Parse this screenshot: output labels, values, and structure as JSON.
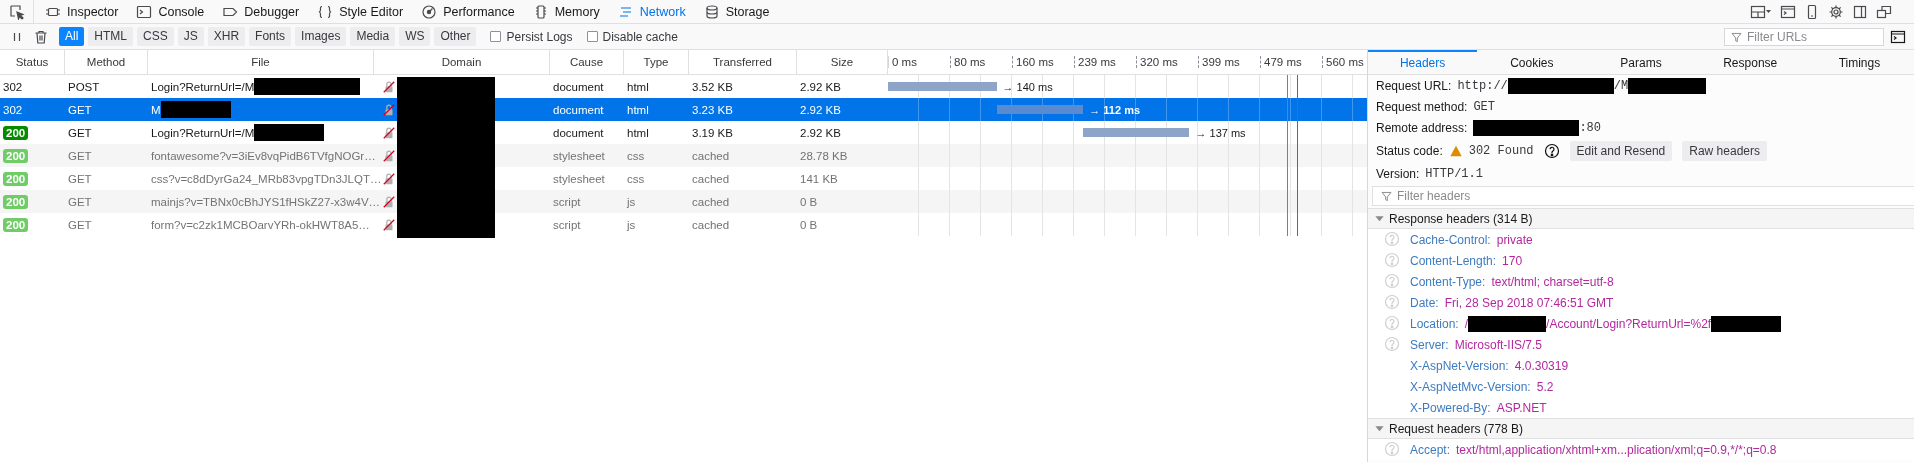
{
  "tools": {
    "tabs": [
      {
        "label": "Inspector",
        "selected": false
      },
      {
        "label": "Console",
        "selected": false
      },
      {
        "label": "Debugger",
        "selected": false
      },
      {
        "label": "Style Editor",
        "selected": false
      },
      {
        "label": "Performance",
        "selected": false
      },
      {
        "label": "Memory",
        "selected": false
      },
      {
        "label": "Network",
        "selected": true
      },
      {
        "label": "Storage",
        "selected": false
      }
    ]
  },
  "filters": {
    "buttons": [
      {
        "label": "All",
        "selected": true
      },
      {
        "label": "HTML",
        "selected": false
      },
      {
        "label": "CSS",
        "selected": false
      },
      {
        "label": "JS",
        "selected": false
      },
      {
        "label": "XHR",
        "selected": false
      },
      {
        "label": "Fonts",
        "selected": false
      },
      {
        "label": "Images",
        "selected": false
      },
      {
        "label": "Media",
        "selected": false
      },
      {
        "label": "WS",
        "selected": false
      },
      {
        "label": "Other",
        "selected": false
      }
    ],
    "checkboxes": [
      {
        "label": "Persist Logs",
        "checked": false
      },
      {
        "label": "Disable cache",
        "checked": false
      }
    ],
    "search": {
      "placeholder": "Filter URLs"
    }
  },
  "table": {
    "columns": [
      "Status",
      "Method",
      "File",
      "Domain",
      "Cause",
      "Type",
      "Transferred",
      "Size"
    ],
    "domain_redacted": true,
    "waterfall": {
      "ticks": [
        "0 ms",
        "80 ms",
        "160 ms",
        "239 ms",
        "320 ms",
        "399 ms",
        "479 ms",
        "560 ms"
      ],
      "markers": [
        {
          "color": "#3d8fd9"
        },
        {
          "color": "#b434b8"
        }
      ]
    },
    "rows": [
      {
        "kind": "redirect",
        "status": "302",
        "method": "POST",
        "file": [
          {
            "kind": "text",
            "text": "Login?ReturnUrl=/M"
          },
          {
            "kind": "redaction"
          }
        ],
        "cause": "document",
        "type": "html",
        "transferred": "3.52 KB",
        "size": "2.92 KB",
        "timing": "→ 140 ms",
        "cached": false,
        "selected": false
      },
      {
        "kind": "redirect",
        "status": "302",
        "method": "GET",
        "file": [
          {
            "kind": "text",
            "text": "M"
          },
          {
            "kind": "redaction"
          }
        ],
        "cause": "document",
        "type": "html",
        "transferred": "3.23 KB",
        "size": "2.92 KB",
        "timing": "→ 112 ms",
        "cached": false,
        "selected": true
      },
      {
        "kind": "success",
        "status": "200",
        "method": "GET",
        "file": [
          {
            "kind": "text",
            "text": "Login?ReturnUrl=/M"
          },
          {
            "kind": "redaction"
          }
        ],
        "cause": "document",
        "type": "html",
        "transferred": "3.19 KB",
        "size": "2.92 KB",
        "timing": "→ 137 ms",
        "cached": false,
        "selected": false
      },
      {
        "kind": "success",
        "status": "200",
        "method": "GET",
        "file": [
          {
            "kind": "text",
            "text": "fontawesome?v=3iEv8vqPidB6TVfgNOGr…"
          }
        ],
        "cause": "stylesheet",
        "type": "css",
        "transferred": "cached",
        "size": "28.78 KB",
        "cached": true,
        "selected": false
      },
      {
        "kind": "success",
        "status": "200",
        "method": "GET",
        "file": [
          {
            "kind": "text",
            "text": "css?v=c8dDyrGa24_MRb83vpgTDn3JLQT…"
          }
        ],
        "cause": "stylesheet",
        "type": "css",
        "transferred": "cached",
        "size": "141 KB",
        "cached": true,
        "selected": false
      },
      {
        "kind": "success",
        "status": "200",
        "method": "GET",
        "file": [
          {
            "kind": "text",
            "text": "mainjs?v=TBNx0cBhJYS1fHSkZ27-x3w4V…"
          }
        ],
        "cause": "script",
        "type": "js",
        "transferred": "cached",
        "size": "0 B",
        "cached": true,
        "selected": false
      },
      {
        "kind": "success",
        "status": "200",
        "method": "GET",
        "file": [
          {
            "kind": "text",
            "text": "form?v=c2zk1MCBOarvYRh-okHWT8A5…"
          }
        ],
        "cause": "script",
        "type": "js",
        "transferred": "cached",
        "size": "0 B",
        "cached": true,
        "selected": false
      }
    ]
  },
  "details": {
    "tabs": [
      {
        "label": "Headers",
        "selected": true
      },
      {
        "label": "Cookies",
        "selected": false
      },
      {
        "label": "Params",
        "selected": false
      },
      {
        "label": "Response",
        "selected": false
      },
      {
        "label": "Timings",
        "selected": false
      }
    ],
    "summary": [
      {
        "kind": "value",
        "label": "Request URL:",
        "value": [
          {
            "kind": "text",
            "text": "http://"
          },
          {
            "kind": "redaction"
          },
          {
            "kind": "text",
            "text": "/M"
          },
          {
            "kind": "redaction"
          }
        ]
      },
      {
        "kind": "value",
        "label": "Request method:",
        "value": [
          {
            "kind": "text",
            "text": "GET"
          }
        ]
      },
      {
        "kind": "value",
        "label": "Remote address:",
        "value": [
          {
            "kind": "redaction"
          },
          {
            "kind": "text",
            "text": ":80"
          }
        ]
      },
      {
        "kind": "status",
        "label": "Status code:",
        "value": [
          {
            "kind": "text",
            "text": "302 Found"
          }
        ],
        "buttons": [
          "Edit and Resend",
          "Raw headers"
        ]
      },
      {
        "kind": "value",
        "label": "Version:",
        "value": [
          {
            "kind": "text",
            "text": "HTTP/1.1"
          }
        ]
      }
    ],
    "filter": {
      "placeholder": "Filter headers"
    },
    "sections": [
      {
        "title": "Response headers (314 B)",
        "expanded": true,
        "headers": [
          {
            "name": "Cache-Control:",
            "value": [
              {
                "kind": "text",
                "text": "private"
              }
            ],
            "help": true
          },
          {
            "name": "Content-Length:",
            "value": [
              {
                "kind": "text",
                "text": "170"
              }
            ],
            "help": true
          },
          {
            "name": "Content-Type:",
            "value": [
              {
                "kind": "text",
                "text": "text/html; charset=utf-8"
              }
            ],
            "help": true
          },
          {
            "name": "Date:",
            "value": [
              {
                "kind": "text",
                "text": "Fri, 28 Sep 2018 07:46:51 GMT"
              }
            ],
            "help": true
          },
          {
            "name": "Location:",
            "value": [
              {
                "kind": "text",
                "text": "/"
              },
              {
                "kind": "redaction"
              },
              {
                "kind": "text",
                "text": "/Account/Login?ReturnUrl=%2f"
              },
              {
                "kind": "redaction"
              }
            ],
            "help": true
          },
          {
            "name": "Server:",
            "value": [
              {
                "kind": "text",
                "text": "Microsoft-IIS/7.5"
              }
            ],
            "help": true
          },
          {
            "name": "X-AspNet-Version:",
            "value": [
              {
                "kind": "text",
                "text": "4.0.30319"
              }
            ],
            "help": false
          },
          {
            "name": "X-AspNetMvc-Version:",
            "value": [
              {
                "kind": "text",
                "text": "5.2"
              }
            ],
            "help": false
          },
          {
            "name": "X-Powered-By:",
            "value": [
              {
                "kind": "text",
                "text": "ASP.NET"
              }
            ],
            "help": false
          }
        ]
      },
      {
        "title": "Request headers (778 B)",
        "expanded": true,
        "headers": [
          {
            "name": "Accept:",
            "value": [
              {
                "kind": "text",
                "text": "text/html,application/xhtml+xm...plication/xml;q=0.9,*/*;q=0.8"
              }
            ],
            "help": true
          }
        ]
      }
    ]
  }
}
